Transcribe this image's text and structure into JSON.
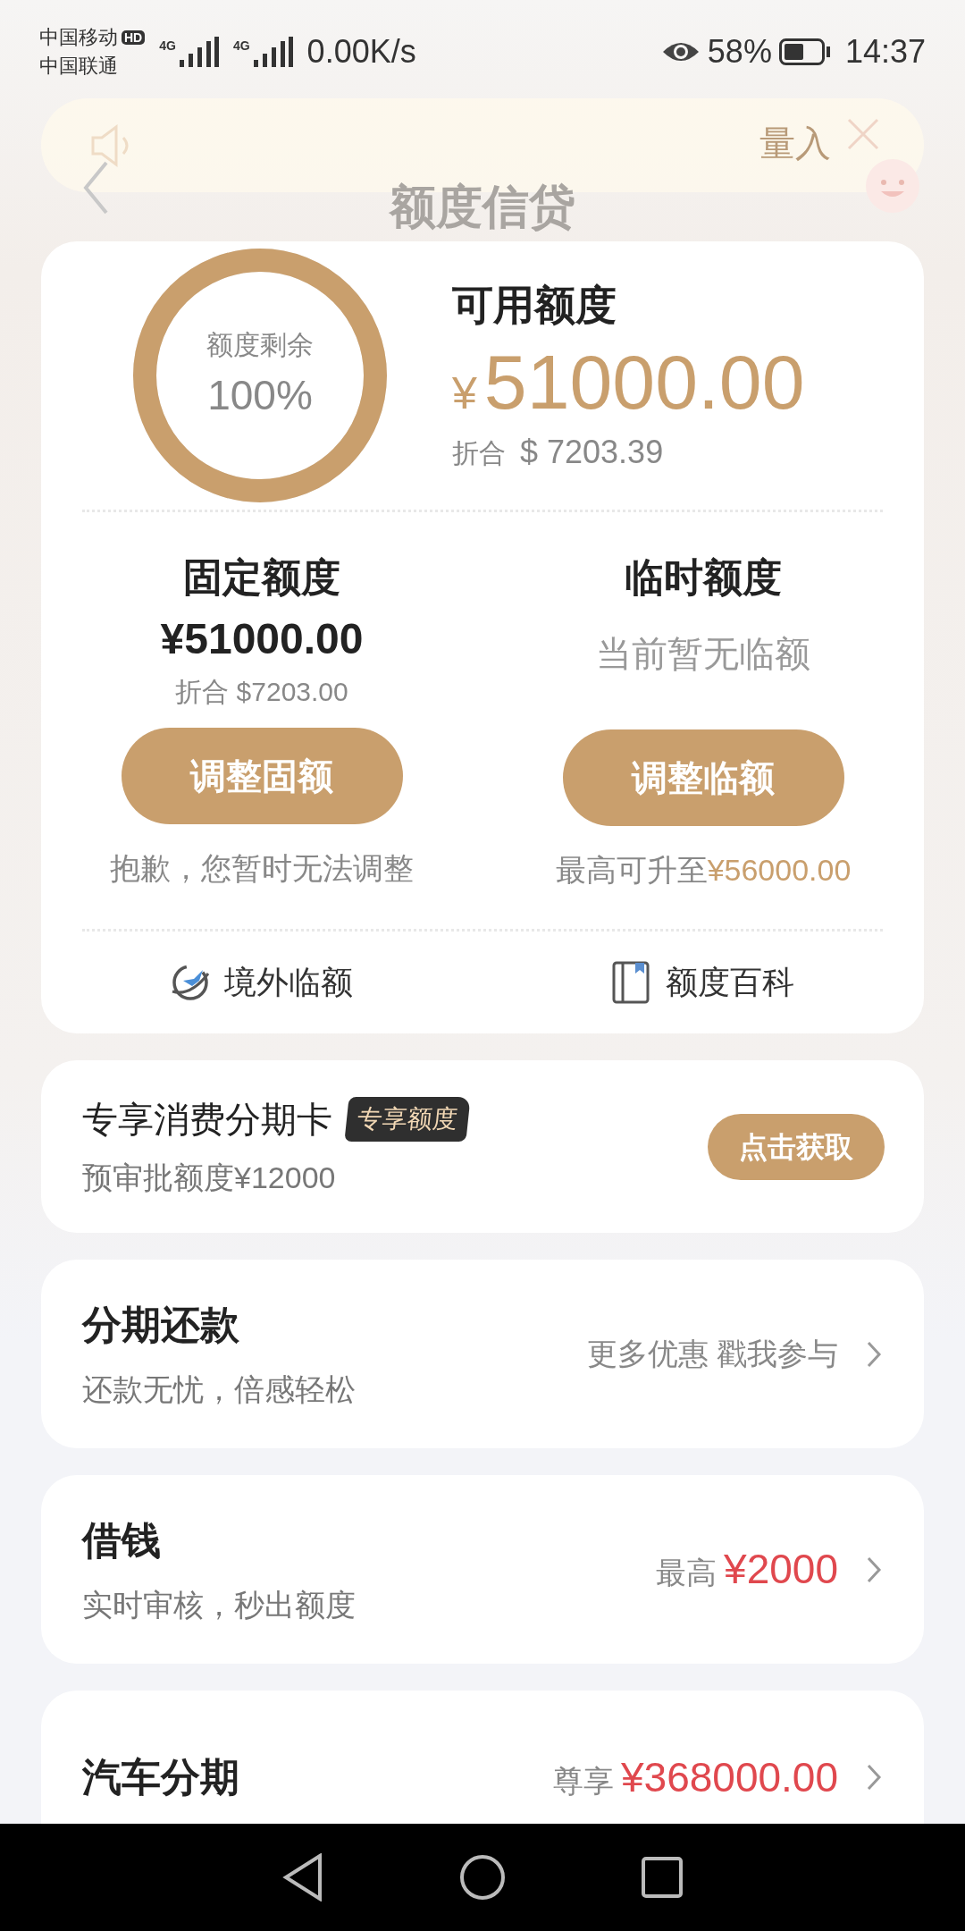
{
  "status_bar": {
    "carrier_1": "中国移动",
    "hd": "HD",
    "carrier_2": "中国联通",
    "net_1": "4G",
    "net_2": "4G",
    "speed": "0.00K/s",
    "battery": "58%",
    "time": "14:37"
  },
  "header": {
    "title": "额度信贷",
    "notice": "量入"
  },
  "credit": {
    "ring_label": "额度剩余",
    "ring_percent": "100%",
    "level": 1,
    "available_label": "可用额度",
    "currency": "¥",
    "available_amount": "51000.00",
    "converted_label": "折合",
    "converted_value": "$ 7203.39"
  },
  "limits": [
    {
      "title": "固定额度",
      "amount": "¥51000.00",
      "converted": "折合 $7203.00",
      "button": "调整固额",
      "note": "抱歉，您暂时无法调整"
    },
    {
      "title": "临时额度",
      "empty_text": "当前暂无临额",
      "button": "调整临额",
      "note": "最高可升至",
      "note_amount": "¥56000.00"
    }
  ],
  "links": [
    {
      "kind": "plane",
      "label": "境外临额"
    },
    {
      "kind": "book",
      "label": "额度百科"
    }
  ],
  "promo": {
    "title": "专享消费分期卡",
    "tag": "专享额度",
    "subtitle": "预审批额度¥12000",
    "button": "点击获取"
  },
  "services": [
    {
      "title": "分期还款",
      "subtitle": "还款无忧，倍感轻松",
      "prefix": "更多优惠 戳我参与"
    },
    {
      "title": "借钱",
      "subtitle": "实时审核，秒出额度",
      "prefix": "最高",
      "amount": "¥2000"
    },
    {
      "title": "汽车分期",
      "prefix": "尊享",
      "amount": "¥368000.00"
    }
  ]
}
